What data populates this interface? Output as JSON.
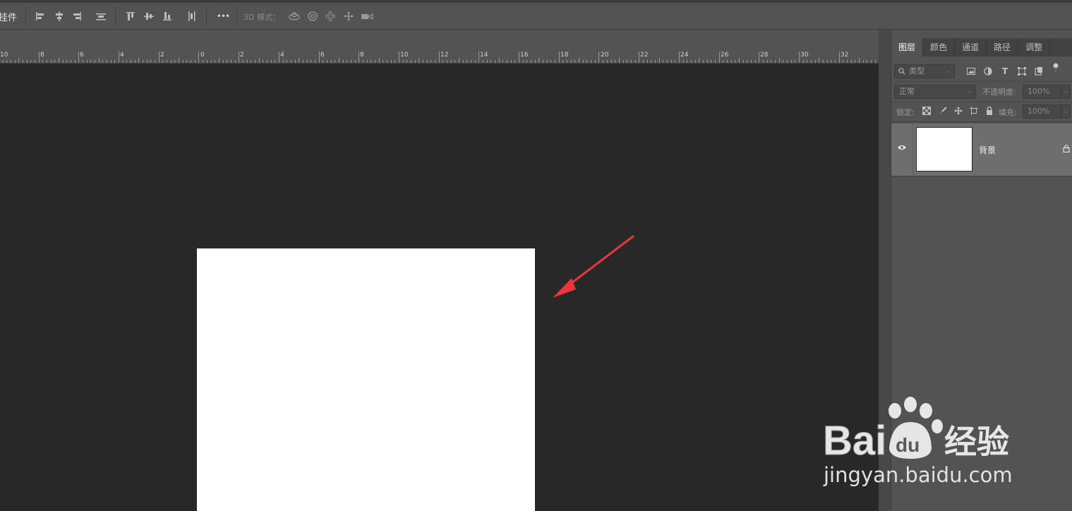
{
  "toolbar": {
    "partial_label": "挂件",
    "mode_label": "3D 模式：",
    "more_label": "•••",
    "icons": [
      "align-left-edges-icon",
      "align-horizontal-centers-icon",
      "align-right-edges-icon",
      "distribute-horizontal-icon",
      "align-top-edges-icon",
      "align-vertical-centers-icon",
      "align-bottom-edges-icon",
      "distribute-vertical-icon",
      "more-options-icon",
      "3d-orbit-icon",
      "3d-roll-icon",
      "3d-pan-icon",
      "3d-slide-icon",
      "3d-camera-icon"
    ]
  },
  "ruler": {
    "labels": [
      "10",
      "8",
      "6",
      "4",
      "2",
      "0",
      "2",
      "4",
      "6",
      "8",
      "10",
      "12",
      "14",
      "16",
      "18",
      "20",
      "22",
      "24",
      "26",
      "28",
      "30",
      "32"
    ]
  },
  "layers_panel": {
    "tabs": [
      {
        "label": "图层",
        "active": true
      },
      {
        "label": "颜色",
        "active": false
      },
      {
        "label": "通道",
        "active": false
      },
      {
        "label": "路径",
        "active": false
      },
      {
        "label": "调整",
        "active": false
      }
    ],
    "filter_placeholder": "类型",
    "blend_mode": "正常",
    "opacity_label": "不透明度:",
    "opacity_value": "100%",
    "lock_label": "锁定:",
    "fill_label": "填充:",
    "fill_value": "100%",
    "layers": [
      {
        "name": "背景",
        "visible": true,
        "locked": true
      }
    ]
  },
  "watermark": {
    "brand_left": "Bai",
    "brand_paw": "du",
    "brand_right": "经验",
    "url": "jingyan.baidu.com"
  },
  "colors": {
    "toolbar_bg": "#535353",
    "canvas_bg": "#282828",
    "document": "#ffffff",
    "arrow": "#e8363d",
    "active_layer_row": "#6e6e6e"
  }
}
